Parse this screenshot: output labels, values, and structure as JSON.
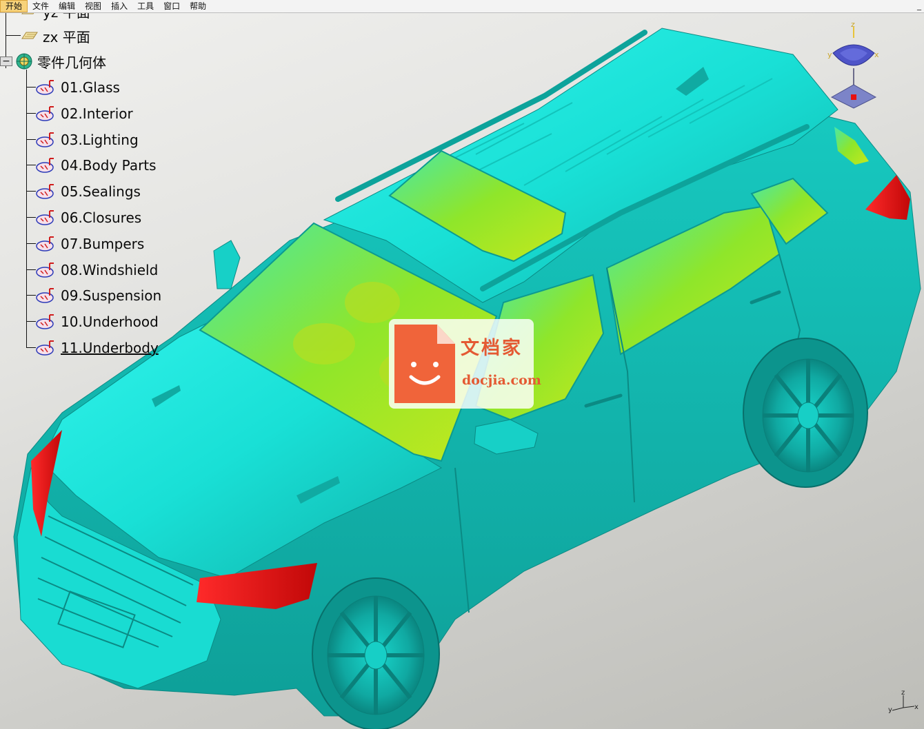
{
  "menu": {
    "items": [
      {
        "label": "开始",
        "active": true
      },
      {
        "label": "文件",
        "active": false
      },
      {
        "label": "编辑",
        "active": false
      },
      {
        "label": "视图",
        "active": false
      },
      {
        "label": "插入",
        "active": false
      },
      {
        "label": "工具",
        "active": false
      },
      {
        "label": "窗口",
        "active": false
      },
      {
        "label": "帮助",
        "active": false
      }
    ],
    "window_control": "_"
  },
  "tree": {
    "partial_top_label": "yz 平面",
    "plane_zx_label": "zx 平面",
    "geometry_root_label": "零件几何体",
    "expand_toggle": "−",
    "parts": [
      {
        "label": "01.Glass"
      },
      {
        "label": "02.Interior"
      },
      {
        "label": "03.Lighting"
      },
      {
        "label": "04.Body Parts"
      },
      {
        "label": "05.Sealings"
      },
      {
        "label": "06.Closures"
      },
      {
        "label": "07.Bumpers"
      },
      {
        "label": "08.Windshield"
      },
      {
        "label": "09.Suspension"
      },
      {
        "label": "10.Underhood"
      },
      {
        "label": "11.Underbody",
        "selected": true
      }
    ]
  },
  "compass": {
    "z_label": "z",
    "x_label": "x",
    "y_label": "y"
  },
  "axis_indicator": {
    "x_label": "x",
    "y_label": "y",
    "z_label": "z"
  },
  "watermark": {
    "cn": "文档家",
    "en": "docjia.com"
  },
  "colors": {
    "body": "#19e6dc",
    "body_shade": "#10b8b0",
    "glass": "#9ee62a",
    "lights": "#e00f0f",
    "menu_active": "#f7d27a"
  }
}
